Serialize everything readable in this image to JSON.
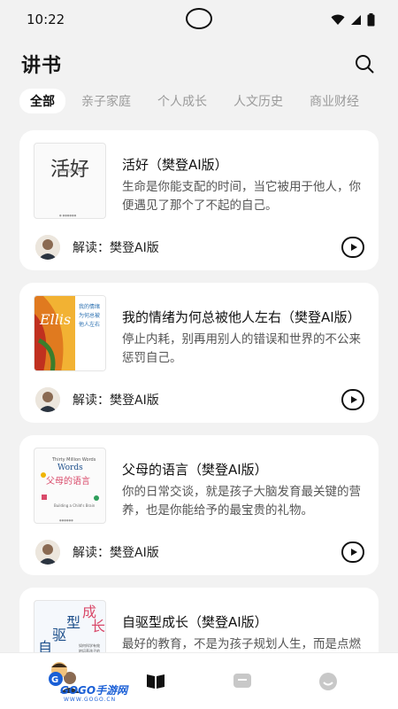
{
  "status_bar": {
    "time": "10:22"
  },
  "header": {
    "title": "讲书",
    "search_icon": "search-icon"
  },
  "tabs": [
    {
      "label": "全部",
      "active": true
    },
    {
      "label": "亲子家庭",
      "active": false
    },
    {
      "label": "个人成长",
      "active": false
    },
    {
      "label": "人文历史",
      "active": false
    },
    {
      "label": "商业财经",
      "active": false
    }
  ],
  "books": [
    {
      "title": "活好（樊登AI版）",
      "desc": "生命是你能支配的时间，当它被用于他人，你便遇见了那个了不起的自己。",
      "interpreter": "解读：樊登AI版",
      "cover_text": "活好",
      "cover_sub": "我这样活到100岁"
    },
    {
      "title": "我的情绪为何总被他人左右（樊登AI版）",
      "desc": "停止内耗，别再用别人的错误和世界的不公来惩罚自己。",
      "interpreter": "解读：樊登AI版",
      "cover_text": "Ellis",
      "cover_sub": "我的情绪为何总被他人左右"
    },
    {
      "title": "父母的语言（樊登AI版）",
      "desc": "你的日常交谈，就是孩子大脑发育最关键的营养，也是你能给予的最宝贵的礼物。",
      "interpreter": "解读：樊登AI版",
      "cover_text": "父母的语言",
      "cover_sub": "Thirty Million Words"
    },
    {
      "title": "自驱型成长（樊登AI版）",
      "desc": "最好的教育，不是为孩子规划人生，而是点燃他为自己奋斗的意愿。",
      "interpreter": "",
      "cover_text": "自驱型成长",
      "cover_sub": ""
    }
  ],
  "watermark": {
    "brand": "GOGO手游网",
    "url": "WWW.GOGO.CN"
  },
  "colors": {
    "accent": "#111111",
    "background": "#f2f2f2",
    "card": "#ffffff",
    "inactive_tab": "#9a9a9a"
  }
}
